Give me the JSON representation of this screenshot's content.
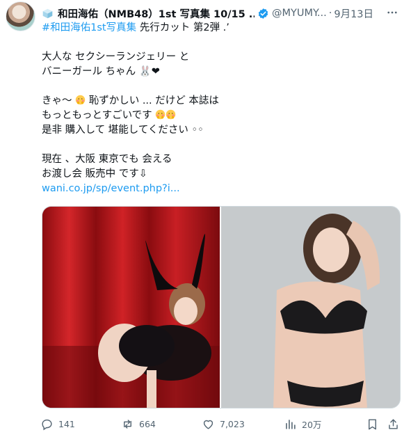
{
  "author": {
    "name": "和田海佑（NMB48）1st 写真集 10/15 ...",
    "handle": "@MYUMY...",
    "separator": "·",
    "date": "9月13日"
  },
  "post": {
    "hashtag": "#和田海佑1st写真集",
    "line1_rest": " 先行カット 第2弾 .’",
    "line2": "大人な セクシーランジェリー と",
    "line3": "バニーガール ちゃん 🐰❤",
    "line4a": "きゃ〜 ",
    "line4b": " 恥ずかしい ... だけど 本誌は",
    "line5": "もっともっとすごいです ",
    "line6": "是非 購入して 堪能してください ◦◦",
    "line7": "現在 、大阪 東京でも 会える",
    "line8": "お渡し会 販売中 です⇩",
    "link": "wani.co.jp/sp/event.php?i..."
  },
  "media": {
    "images": [
      {
        "alt": "bunny-girl-photo"
      },
      {
        "alt": "lingerie-photo"
      }
    ]
  },
  "actions": {
    "replies": "141",
    "reposts": "664",
    "likes": "7,023",
    "views": "20万"
  },
  "colors": {
    "link": "#1d9bf0",
    "muted": "#536471",
    "verified": "#1d9bf0"
  }
}
